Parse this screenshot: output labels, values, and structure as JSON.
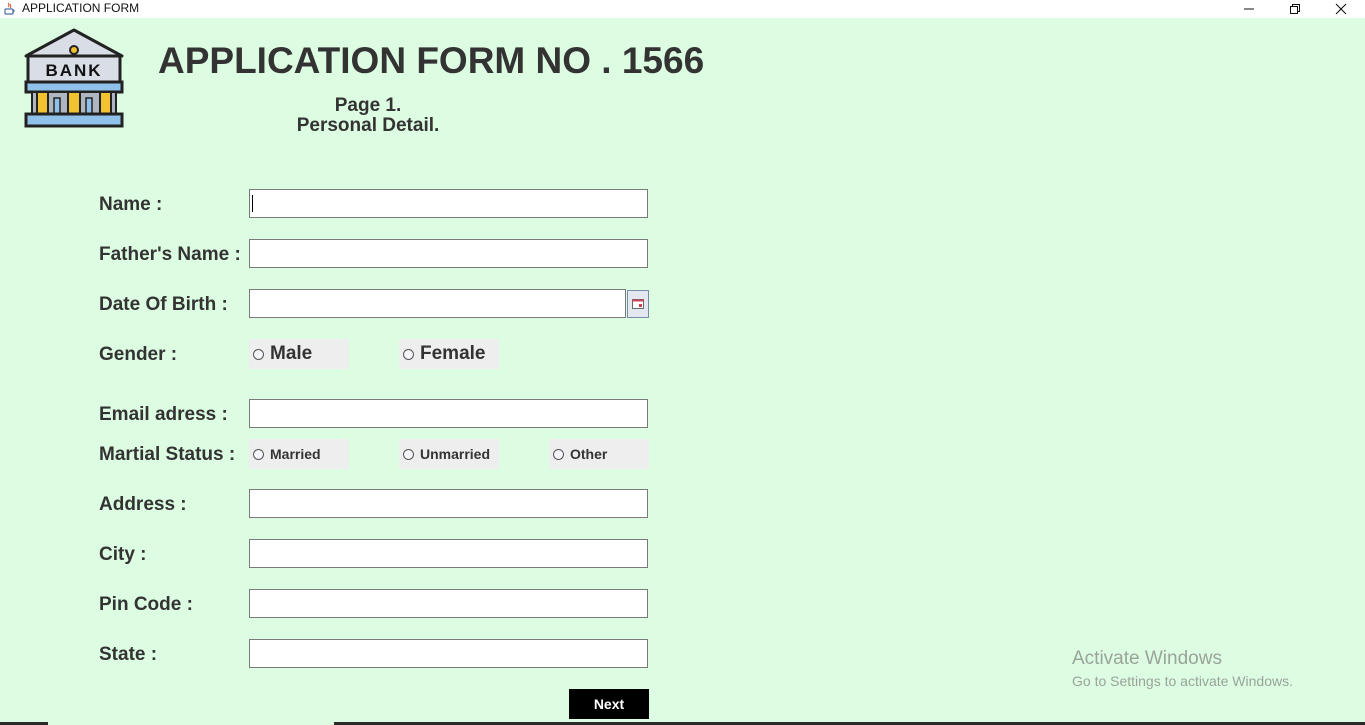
{
  "window": {
    "title": "APPLICATION FORM",
    "minimize_icon": "minimize-icon",
    "maximize_icon": "restore-icon",
    "close_icon": "close-icon"
  },
  "logo": {
    "text": "BANK",
    "icon": "bank-building-icon"
  },
  "header": {
    "title": "APPLICATION FORM NO . 1566",
    "page": "Page 1.",
    "section": "Personal Detail."
  },
  "form": {
    "name_label": "Name :",
    "name_value": "",
    "father_label": "Father's Name :",
    "father_value": "",
    "dob_label": "Date Of Birth :",
    "dob_value": "",
    "dob_icon": "calendar-icon",
    "gender_label": "Gender :",
    "gender_options": [
      "Male",
      "Female"
    ],
    "email_label": "Email adress :",
    "email_value": "",
    "marital_label": "Martial Status :",
    "marital_options": [
      "Married",
      "Unmarried",
      "Other"
    ],
    "address_label": "Address :",
    "address_value": "",
    "city_label": "City :",
    "city_value": "",
    "pin_label": "Pin Code :",
    "pin_value": "",
    "state_label": "State :",
    "state_value": "",
    "next_label": "Next"
  },
  "watermark": {
    "line1": "Activate Windows",
    "line2": "Go to Settings to activate Windows."
  },
  "colors": {
    "background": "#ddfde2",
    "text": "#333333",
    "button": "#000000",
    "radio_bg": "#eeeeee"
  }
}
